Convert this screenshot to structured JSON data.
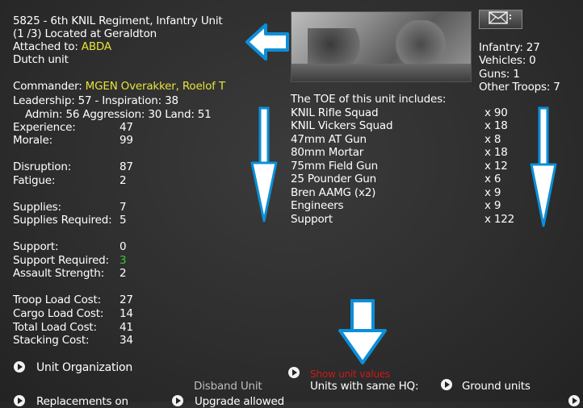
{
  "unit": {
    "line1": "5825 - 6th KNIL Regiment, Infantry Unit",
    "line2": "(1 /3) Located at  Geraldton",
    "attached_label": "Attached to: ",
    "attached_value": "ABDA",
    "nationality": "Dutch unit"
  },
  "commander": {
    "label": "Commander: ",
    "name": "MGEN Overakker, Roelof T",
    "leadership_line": "Leadership: 57 - Inspiration: 38",
    "admin_line": "Admin: 56  Aggression: 30 Land: 51"
  },
  "stats": [
    {
      "label": "Experience:",
      "value": "47"
    },
    {
      "label": "Morale:",
      "value": "99"
    },
    {
      "label": "Disruption:",
      "value": "87"
    },
    {
      "label": "Fatigue:",
      "value": "2"
    },
    {
      "label": "Supplies:",
      "value": "7"
    },
    {
      "label": "Supplies Required:",
      "value": "5"
    },
    {
      "label": "Support:",
      "value": "0"
    },
    {
      "label": "Support Required:",
      "value": "3"
    },
    {
      "label": "Assault Strength:",
      "value": "2"
    },
    {
      "label": "Troop Load Cost:",
      "value": "27"
    },
    {
      "label": "Cargo Load Cost:",
      "value": "14"
    },
    {
      "label": "Total Load Cost:",
      "value": "41"
    },
    {
      "label": "Stacking Cost:",
      "value": "34"
    }
  ],
  "counts": {
    "infantry": "Infantry: 27",
    "vehicles": "Vehicles: 0",
    "guns": "Guns: 1",
    "other": "Other Troops: 7"
  },
  "toe": {
    "heading": "The TOE of this unit includes:",
    "items": [
      {
        "name": "KNIL Rifle Squad",
        "qty": "x 90"
      },
      {
        "name": "KNIL Vickers Squad",
        "qty": "x 18"
      },
      {
        "name": "47mm AT Gun",
        "qty": "x 8"
      },
      {
        "name": "80mm Mortar",
        "qty": "x 18"
      },
      {
        "name": "75mm Field Gun",
        "qty": "x 12"
      },
      {
        "name": "25 Pounder Gun",
        "qty": "x 6"
      },
      {
        "name": "Bren AAMG (x2)",
        "qty": "x 9"
      },
      {
        "name": "Engineers",
        "qty": "x 9"
      },
      {
        "name": "Support",
        "qty": "x 122"
      }
    ]
  },
  "actions": {
    "unit_org": "Unit Organization",
    "disband": "Disband Unit",
    "show_values": "Show unit values",
    "units_same_hq": "Units with same HQ:",
    "ground_units": "Ground units",
    "bottom_left": "Replacements on",
    "bottom_mid": "Upgrade allowed"
  },
  "colors": {
    "highlight": "#e8e23a",
    "good": "#33cc33",
    "warning": "#cc1a1a",
    "arrow": "#0b8fd8"
  },
  "icons": {
    "mail": "envelope-icon",
    "bullet": "arrow-bullet-icon"
  }
}
